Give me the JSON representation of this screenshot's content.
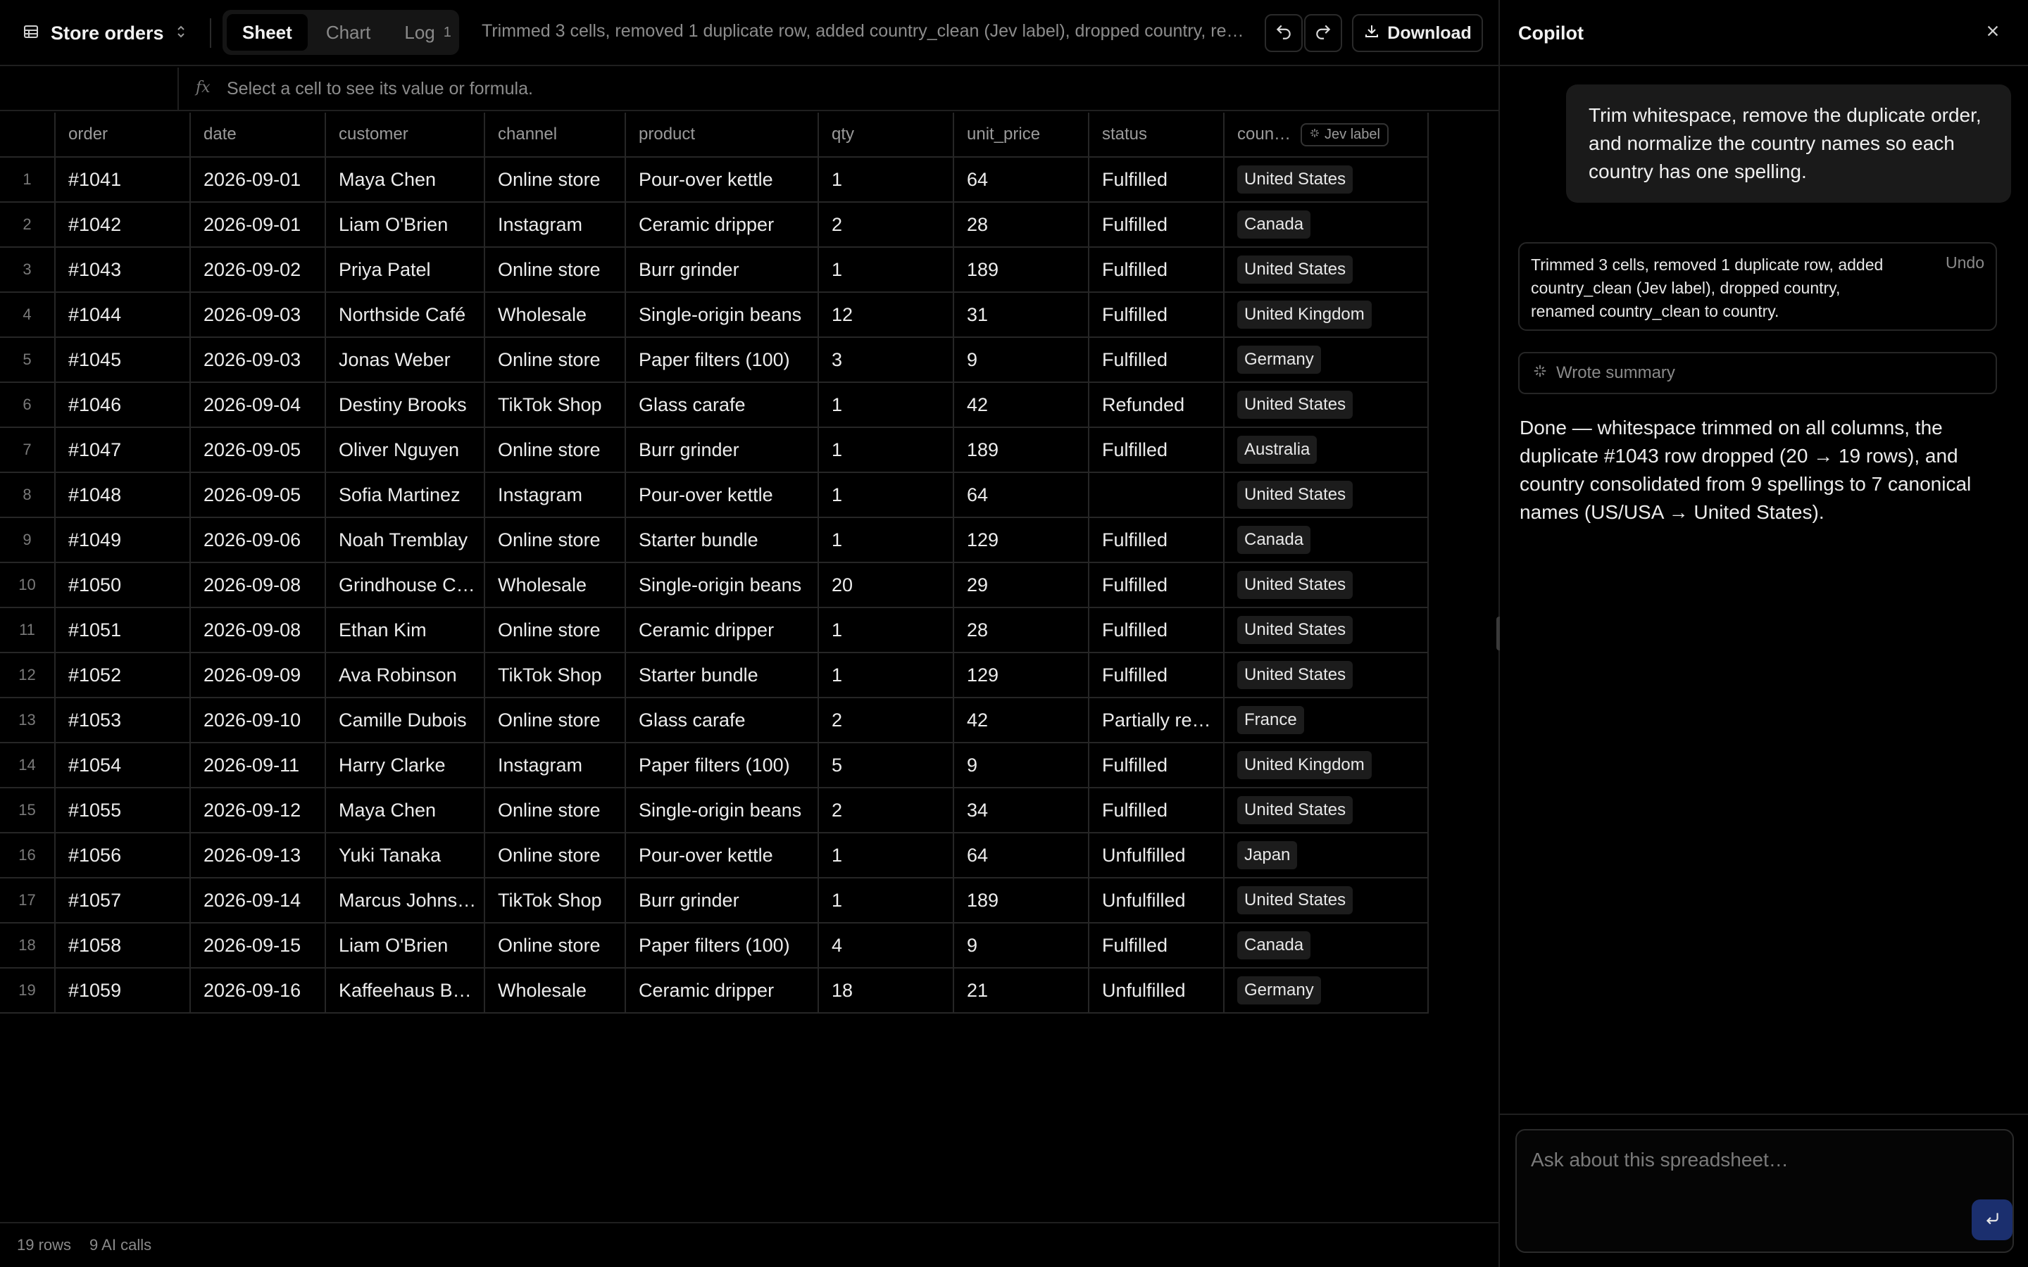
{
  "header": {
    "title": "Store orders",
    "tabs": [
      {
        "label": "Sheet",
        "badge": ""
      },
      {
        "label": "Chart",
        "badge": ""
      },
      {
        "label": "Log",
        "badge": "1"
      }
    ],
    "status": "Trimmed 3 cells, removed 1 duplicate row, added country_clean (Jev label), dropped country, renamed country_clean to country.",
    "download_label": "Download",
    "icons": {
      "sheet": "table-icon",
      "switch": "chevron-updown-icon",
      "undo": "undo-icon",
      "redo": "redo-icon",
      "download": "download-icon"
    }
  },
  "formula_bar": {
    "fx": "fx",
    "placeholder": "Select a cell to see its value or formula."
  },
  "columns": [
    "order",
    "date",
    "customer",
    "channel",
    "product",
    "qty",
    "unit_price",
    "status",
    "coun…"
  ],
  "country_tag": "Jev label",
  "rows": [
    [
      "#1041",
      "2026-09-01",
      "Maya Chen",
      "Online store",
      "Pour-over kettle",
      "1",
      "64",
      "Fulfilled",
      "United States"
    ],
    [
      "#1042",
      "2026-09-01",
      "Liam O'Brien",
      "Instagram",
      "Ceramic dripper",
      "2",
      "28",
      "Fulfilled",
      "Canada"
    ],
    [
      "#1043",
      "2026-09-02",
      "Priya Patel",
      "Online store",
      "Burr grinder",
      "1",
      "189",
      "Fulfilled",
      "United States"
    ],
    [
      "#1044",
      "2026-09-03",
      "Northside Café",
      "Wholesale",
      "Single-origin beans",
      "12",
      "31",
      "Fulfilled",
      "United Kingdom"
    ],
    [
      "#1045",
      "2026-09-03",
      "Jonas Weber",
      "Online store",
      "Paper filters (100)",
      "3",
      "9",
      "Fulfilled",
      "Germany"
    ],
    [
      "#1046",
      "2026-09-04",
      "Destiny Brooks",
      "TikTok Shop",
      "Glass carafe",
      "1",
      "42",
      "Refunded",
      "United States"
    ],
    [
      "#1047",
      "2026-09-05",
      "Oliver Nguyen",
      "Online store",
      "Burr grinder",
      "1",
      "189",
      "Fulfilled",
      "Australia"
    ],
    [
      "#1048",
      "2026-09-05",
      "Sofia Martinez",
      "Instagram",
      "Pour-over kettle",
      "1",
      "64",
      "",
      "United States"
    ],
    [
      "#1049",
      "2026-09-06",
      "Noah Tremblay",
      "Online store",
      "Starter bundle",
      "1",
      "129",
      "Fulfilled",
      "Canada"
    ],
    [
      "#1050",
      "2026-09-08",
      "Grindhouse Coffee",
      "Wholesale",
      "Single-origin beans",
      "20",
      "29",
      "Fulfilled",
      "United States"
    ],
    [
      "#1051",
      "2026-09-08",
      "Ethan Kim",
      "Online store",
      "Ceramic dripper",
      "1",
      "28",
      "Fulfilled",
      "United States"
    ],
    [
      "#1052",
      "2026-09-09",
      "Ava Robinson",
      "TikTok Shop",
      "Starter bundle",
      "1",
      "129",
      "Fulfilled",
      "United States"
    ],
    [
      "#1053",
      "2026-09-10",
      "Camille Dubois",
      "Online store",
      "Glass carafe",
      "2",
      "42",
      "Partially refunded",
      "France"
    ],
    [
      "#1054",
      "2026-09-11",
      "Harry Clarke",
      "Instagram",
      "Paper filters (100)",
      "5",
      "9",
      "Fulfilled",
      "United Kingdom"
    ],
    [
      "#1055",
      "2026-09-12",
      "Maya Chen",
      "Online store",
      "Single-origin beans",
      "2",
      "34",
      "Fulfilled",
      "United States"
    ],
    [
      "#1056",
      "2026-09-13",
      "Yuki Tanaka",
      "Online store",
      "Pour-over kettle",
      "1",
      "64",
      "Unfulfilled",
      "Japan"
    ],
    [
      "#1057",
      "2026-09-14",
      "Marcus Johnson",
      "TikTok Shop",
      "Burr grinder",
      "1",
      "189",
      "Unfulfilled",
      "United States"
    ],
    [
      "#1058",
      "2026-09-15",
      "Liam O'Brien",
      "Online store",
      "Paper filters (100)",
      "4",
      "9",
      "Fulfilled",
      "Canada"
    ],
    [
      "#1059",
      "2026-09-16",
      "Kaffeehaus Berlin",
      "Wholesale",
      "Ceramic dripper",
      "18",
      "21",
      "Unfulfilled",
      "Germany"
    ]
  ],
  "footer": {
    "rows": "19 rows",
    "ai_calls": "9 AI calls"
  },
  "copilot": {
    "title": "Copilot",
    "user_message": "Trim whitespace, remove the duplicate order, and normalize the country names so each country has one spelling.",
    "action_summary": "Trimmed 3 cells, removed 1 duplicate row, added country_clean (Jev label), dropped country, renamed country_clean to country.",
    "undo_label": "Undo",
    "summary_label": "Wrote summary",
    "assistant_message": "Done — whitespace trimmed on all columns, the duplicate #1043 row dropped (20 → 19 rows), and country consolidated from 9 spellings to 7 canonical names (US/USA → United States).",
    "input_placeholder": "Ask about this spreadsheet…"
  }
}
